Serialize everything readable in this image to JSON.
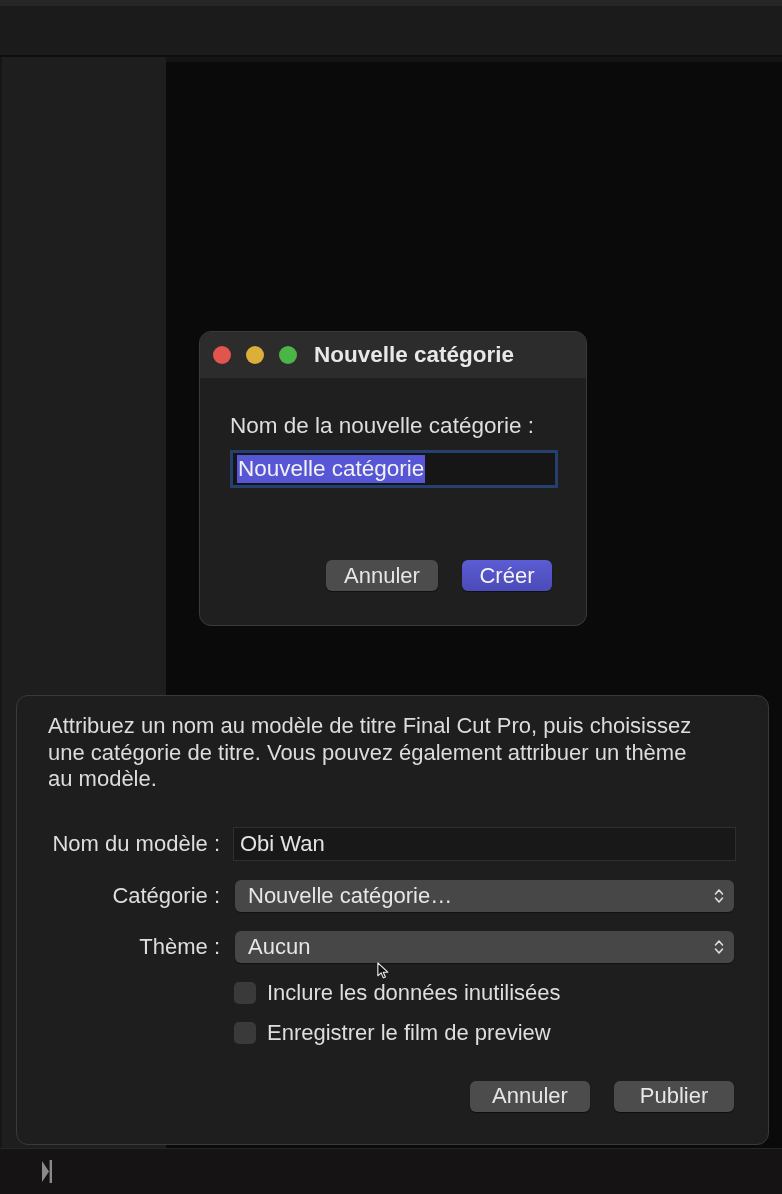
{
  "dialog": {
    "title": "Nouvelle catégorie",
    "window_controls": [
      {
        "kind": "close"
      },
      {
        "kind": "minimize"
      },
      {
        "kind": "zoom"
      }
    ],
    "field_label": "Nom de la nouvelle catégorie :",
    "field": {
      "value": "Nouvelle catégorie",
      "focused": true,
      "text_selected": true
    },
    "buttons": [
      {
        "label": "Annuler",
        "default": false
      },
      {
        "label": "Créer",
        "default": true
      }
    ]
  },
  "sheet": {
    "description": "Attribuez un nom au modèle de titre Final Cut Pro, puis choisissez une catégorie de titre. Vous pouvez également attribuer un thème au modèle.",
    "fields": [
      {
        "kind": "text",
        "label": "Nom du modèle :",
        "value": "Obi Wan"
      },
      {
        "kind": "popup",
        "label": "Catégorie :",
        "value": "Nouvelle catégorie…"
      },
      {
        "kind": "popup",
        "label": "Thème :",
        "value": "Aucun"
      }
    ],
    "checkboxes": [
      {
        "label": "Inclure les données inutilisées",
        "checked": false
      },
      {
        "label": "Enregistrer le film de preview",
        "checked": false
      }
    ],
    "buttons": [
      {
        "label": "Annuler",
        "default": false
      },
      {
        "label": "Publier",
        "default": false
      }
    ]
  }
}
